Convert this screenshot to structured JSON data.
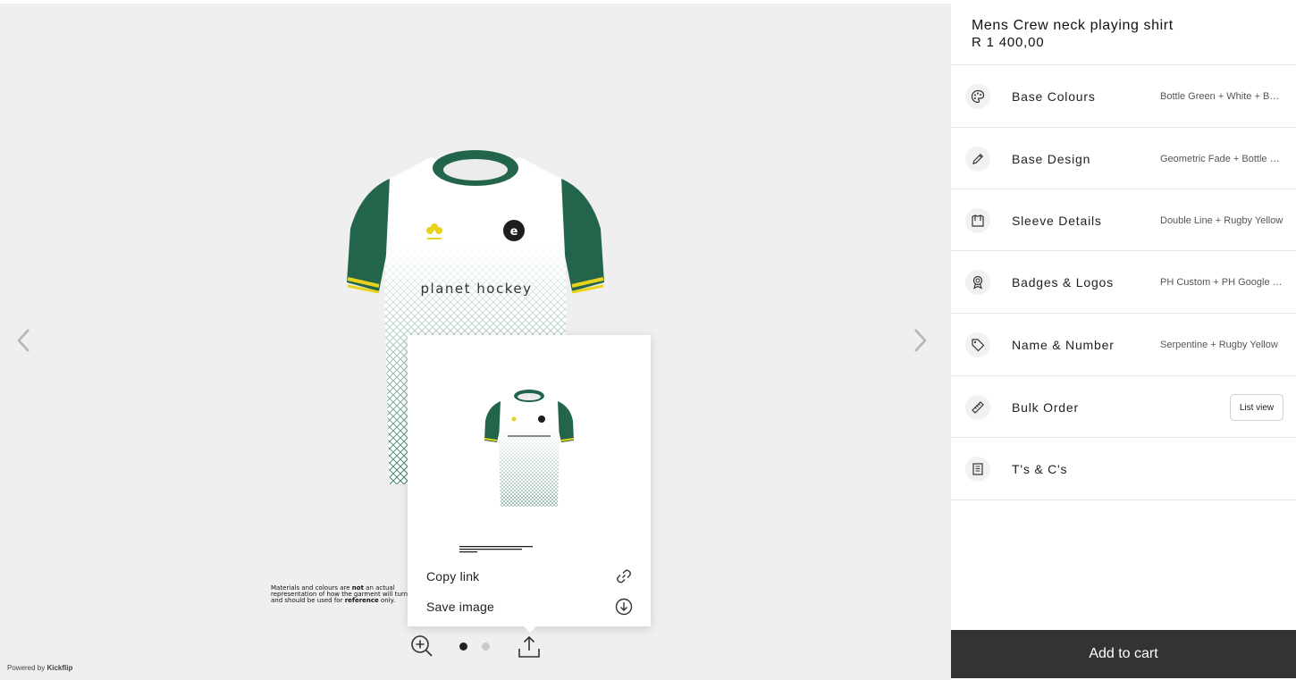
{
  "product": {
    "title": "Mens Crew neck playing shirt",
    "price": "R 1 400,00"
  },
  "options": [
    {
      "label": "Base Colours",
      "value": "Bottle Green + White + Bottle Green",
      "icon": "palette-icon"
    },
    {
      "label": "Base Design",
      "value": "Geometric Fade + Bottle Green",
      "icon": "pencil-icon"
    },
    {
      "label": "Sleeve Details",
      "value": "Double Line + Rugby Yellow",
      "icon": "shirt-icon"
    },
    {
      "label": "Badges & Logos",
      "value": "PH Custom + PH Google Logo",
      "icon": "badge-icon"
    },
    {
      "label": "Name & Number",
      "value": "Serpentine + Rugby Yellow",
      "icon": "tag-icon"
    },
    {
      "label": "Bulk Order",
      "button": "List view",
      "icon": "ruler-icon"
    },
    {
      "label": "T's & C's",
      "icon": "document-icon"
    }
  ],
  "cart": {
    "label": "Add to cart"
  },
  "share": {
    "copy_label": "Copy link",
    "save_label": "Save image"
  },
  "viewer": {
    "shirt_text": "planet hockey",
    "disclaimer_pre": "Materials and colours are ",
    "disclaimer_bold": "not",
    "disclaimer_post": " an actual representation of how the garment will turn out and should be used for ",
    "disclaimer_bold2": "reference",
    "disclaimer_end": " only."
  },
  "footer": {
    "powered_prefix": "Powered by ",
    "powered_brand": "Kickflip"
  },
  "colors": {
    "bottle_green": "#23654a",
    "rugby_yellow": "#e8d21c",
    "cart_bg": "#333333"
  }
}
